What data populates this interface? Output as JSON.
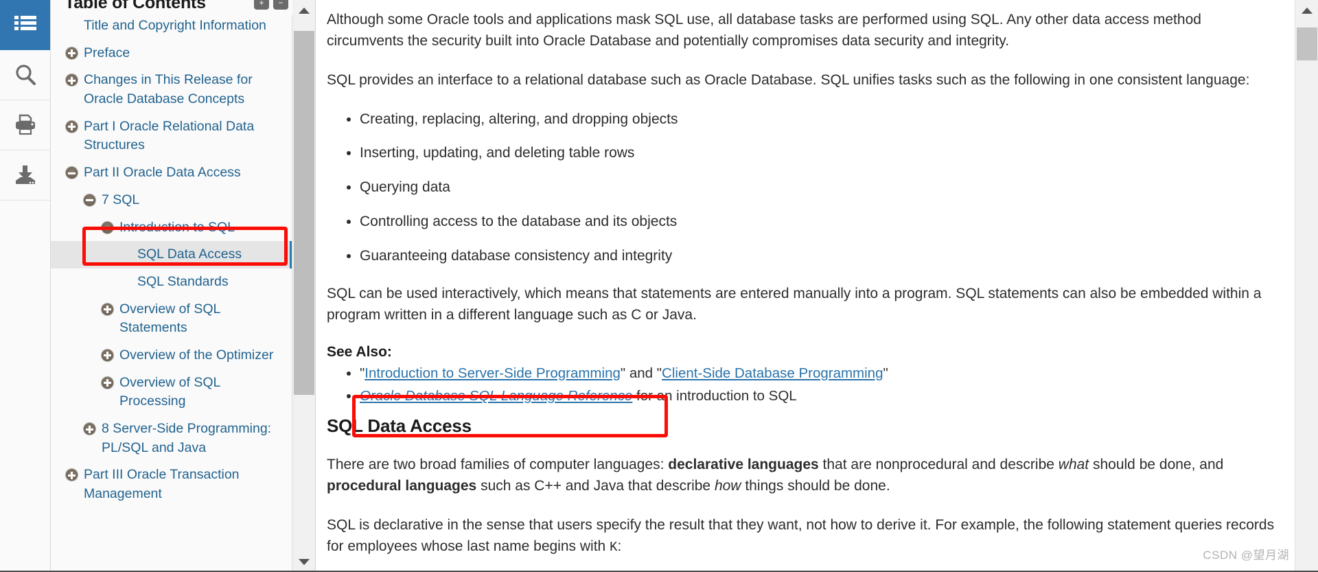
{
  "rail": {
    "items": [
      {
        "name": "contents-icon",
        "label": "Table of Contents",
        "active": true
      },
      {
        "name": "search-icon",
        "label": "Search",
        "active": false
      },
      {
        "name": "print-icon",
        "label": "Print",
        "active": false
      },
      {
        "name": "download-icon",
        "label": "Download",
        "active": false
      }
    ]
  },
  "toc": {
    "title": "Table of Contents",
    "header_icons": [
      "expand-all-icon",
      "collapse-all-icon"
    ],
    "items": [
      {
        "label": "Title and Copyright Information",
        "level": 0,
        "toggle": "none"
      },
      {
        "label": "Preface",
        "level": 0,
        "toggle": "plus"
      },
      {
        "label": "Changes in This Release for Oracle Database Concepts",
        "level": 0,
        "toggle": "plus"
      },
      {
        "label": "Part I Oracle Relational Data Structures",
        "level": 0,
        "toggle": "plus"
      },
      {
        "label": "Part II Oracle Data Access",
        "level": 0,
        "toggle": "minus"
      },
      {
        "label": "7 SQL",
        "level": 1,
        "toggle": "minus"
      },
      {
        "label": "Introduction to SQL",
        "level": 2,
        "toggle": "minus"
      },
      {
        "label": "SQL Data Access",
        "level": 3,
        "toggle": "none",
        "selected": true
      },
      {
        "label": "SQL Standards",
        "level": 3,
        "toggle": "none"
      },
      {
        "label": "Overview of SQL Statements",
        "level": 2,
        "toggle": "plus"
      },
      {
        "label": "Overview of the Optimizer",
        "level": 2,
        "toggle": "plus"
      },
      {
        "label": "Overview of SQL Processing",
        "level": 2,
        "toggle": "plus"
      },
      {
        "label": "8 Server-Side Programming: PL/SQL and Java",
        "level": 1,
        "toggle": "plus"
      },
      {
        "label": "Part III Oracle Transaction Management",
        "level": 0,
        "toggle": "plus"
      }
    ]
  },
  "content": {
    "para1": "Although some Oracle tools and applications mask SQL use, all database tasks are performed using SQL. Any other data access method circumvents the security built into Oracle Database and potentially compromises data security and integrity.",
    "para2": "SQL provides an interface to a relational database such as Oracle Database. SQL unifies tasks such as the following in one consistent language:",
    "bullets": [
      "Creating, replacing, altering, and dropping objects",
      "Inserting, updating, and deleting table rows",
      "Querying data",
      "Controlling access to the database and its objects",
      "Guaranteeing database consistency and integrity"
    ],
    "para3": "SQL can be used interactively, which means that statements are entered manually into a program. SQL statements can also be embedded within a program written in a different language such as C or Java.",
    "see_also_label": "See Also:",
    "see_also": {
      "item1_quote_open": "\"",
      "item1_link1": "Introduction to Server-Side Programming",
      "item1_mid": "\" and \"",
      "item1_link2": "Client-Side Database Programming",
      "item1_quote_close": "\"",
      "item2_link": "Oracle Database SQL Language Reference",
      "item2_tail": " for an introduction to SQL"
    },
    "section_heading": "SQL Data Access",
    "para4_a": "There are two broad families of computer languages: ",
    "para4_b": "declarative languages",
    "para4_c": " that are nonprocedural and describe ",
    "para4_d": "what",
    "para4_e": " should be done, and ",
    "para4_f": "procedural languages",
    "para4_g": " such as C++ and Java that describe ",
    "para4_h": "how",
    "para4_i": " things should be done.",
    "para5_a": "SQL is declarative in the sense that users specify the result that they want, not how to derive it. For example, the following statement queries records for employees whose last name begins with ",
    "para5_code": "K",
    "para5_b": ":"
  },
  "scrollbars": {
    "toc_up_arrow": "chevron-up-icon",
    "toc_down_arrow": "chevron-down-icon",
    "main_up_arrow": "chevron-up-icon"
  },
  "watermark": "CSDN @望月湖",
  "colors": {
    "accent": "#3276b1",
    "link": "#2a73ab",
    "annotation": "#fb0d07",
    "selected_bg": "#e5e5e5",
    "selected_marker": "#2a7ab0"
  }
}
